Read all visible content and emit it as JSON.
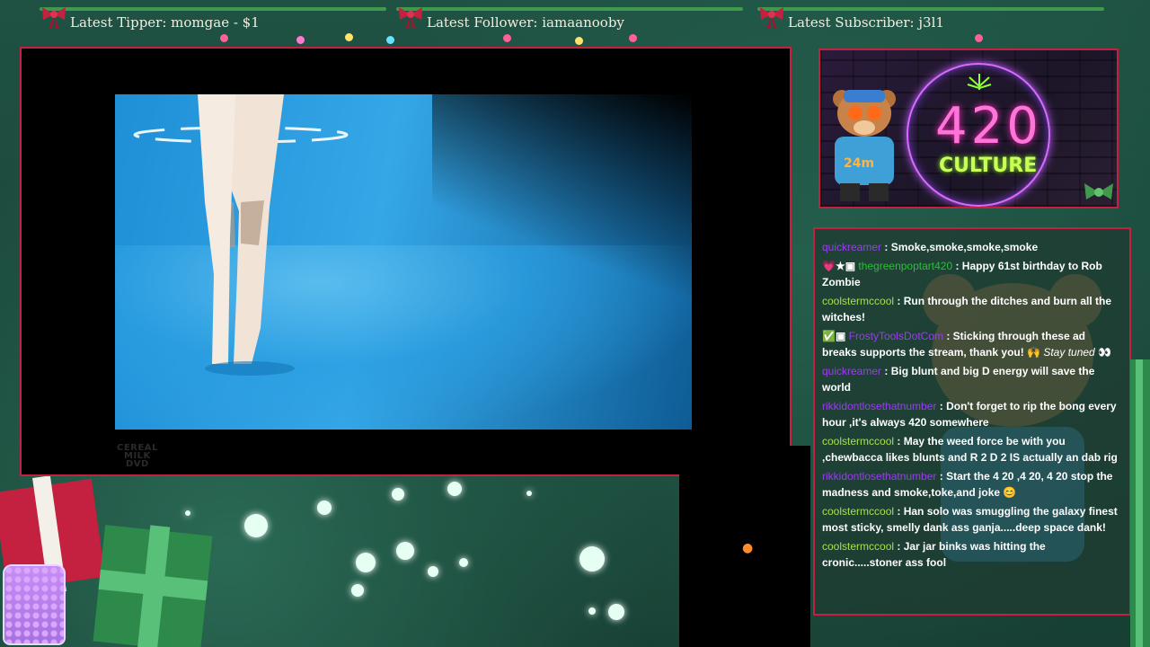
{
  "ticker": {
    "tipper": "Latest Tipper: momgae - $1",
    "follower": "Latest Follower: iamaanooby",
    "subscriber": "Latest Subscriber: j3l1"
  },
  "video": {
    "watermark_line1": "CEREAL",
    "watermark_line2": "MILK",
    "watermark_line3": "DVD"
  },
  "cam": {
    "neon_number": "420",
    "neon_word": "CULTURE",
    "timer": "24m"
  },
  "chat": {
    "messages": [
      {
        "user": "quickreamer",
        "text": " : Smoke,smoke,smoke,smoke",
        "color": "#9b3df0"
      },
      {
        "user": "thegreenpoptart420",
        "text": " : Happy 61st birthday to Rob Zombie",
        "color": "#2fbd3a"
      },
      {
        "user": "coolstermccool",
        "text": " : Run through the ditches and burn all the witches!",
        "color": "#a5e14b"
      },
      {
        "user": "FrostyToolsDotCom",
        "text": " : Sticking through these ad breaks supports the stream, thank you! 🙌 ",
        "extra": "Stay tuned",
        "color": "#9b3df0"
      },
      {
        "user": "quickreamer",
        "text": " : Big blunt and big D energy will save the world",
        "color": "#9b3df0"
      },
      {
        "user": "rikkidontlosethatnumber",
        "text": " : Don't forget to rip the bong every hour ,it's always 420 somewhere",
        "color": "#9b3df0"
      },
      {
        "user": "coolstermccool",
        "text": " : May the weed force be with you ,chewbacca likes blunts and R 2 D 2 IS actually an dab rig",
        "color": "#a5e14b"
      },
      {
        "user": "rikkidontlosethatnumber",
        "text": " : Start the 4 20 ,4 20, 4 20 stop the madness and smoke,toke,and joke 😊",
        "color": "#9b3df0"
      },
      {
        "user": "coolstermccool",
        "text": " : Han solo was smuggling the galaxy finest most sticky, smelly dank ass ganja.....deep space dank!",
        "color": "#a5e14b"
      },
      {
        "user": "coolstermccool",
        "text": " : Jar jar binks was hitting the cronic.....stoner ass fool",
        "color": "#a5e14b"
      }
    ]
  },
  "colors": {
    "frame_border": "#c3213f",
    "ticker_line": "#3f9a4e",
    "background": "#1d4a3c",
    "neon_pink": "#ff74d8",
    "neon_green": "#c9ff56"
  },
  "icons": [
    "bow-icon",
    "bear-avatar-icon",
    "leaf-icon",
    "gift-icon",
    "candy-jar-icon"
  ]
}
